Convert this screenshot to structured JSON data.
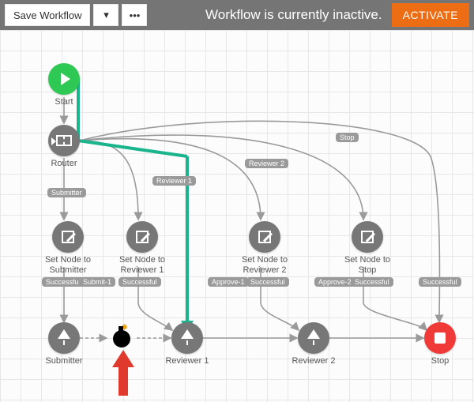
{
  "toolbar": {
    "save_label": "Save Workflow",
    "status": "Workflow is currently inactive.",
    "activate": "ACTIVATE"
  },
  "nodes": {
    "start": "Start",
    "router": "Router",
    "set_submitter": "Set Node to Submitter",
    "set_reviewer1": "Set Node to Reviewer 1",
    "set_reviewer2": "Set Node to Reviewer 2",
    "set_stop": "Set Node to Stop",
    "submitter": "Submitter",
    "reviewer1": "Reviewer 1",
    "reviewer2": "Reviewer 2",
    "stop": "Stop"
  },
  "edges": {
    "submitter": "Submitter",
    "reviewer1": "Reviewer 1",
    "reviewer2": "Reviewer 2",
    "stop": "Stop",
    "successful": "Successful",
    "submit1": "Submit-1",
    "approve1": "Approve-1",
    "approve2": "Approve-2"
  },
  "colors": {
    "accent_green": "#1ab58d",
    "activate_orange": "#ec6d14",
    "start_green": "#2dc954",
    "stop_red": "#ef3a37",
    "node_gray": "#777777",
    "annotation_red": "#e03a2f"
  },
  "chart_data": {
    "type": "diagram",
    "title": "Workflow",
    "nodes": [
      {
        "id": "start",
        "kind": "start",
        "label": "Start"
      },
      {
        "id": "router",
        "kind": "router",
        "label": "Router"
      },
      {
        "id": "sn_sub",
        "kind": "action",
        "label": "Set Node to Submitter"
      },
      {
        "id": "sn_r1",
        "kind": "action",
        "label": "Set Node to Reviewer 1"
      },
      {
        "id": "sn_r2",
        "kind": "action",
        "label": "Set Node to Reviewer 2"
      },
      {
        "id": "sn_stop",
        "kind": "action",
        "label": "Set Node to Stop"
      },
      {
        "id": "submitter",
        "kind": "merge",
        "label": "Submitter"
      },
      {
        "id": "reviewer1",
        "kind": "merge",
        "label": "Reviewer 1"
      },
      {
        "id": "reviewer2",
        "kind": "merge",
        "label": "Reviewer 2"
      },
      {
        "id": "stop",
        "kind": "stop",
        "label": "Stop"
      },
      {
        "id": "bomb",
        "kind": "error",
        "label": ""
      }
    ],
    "edges": [
      {
        "from": "start",
        "to": "router",
        "label": null
      },
      {
        "from": "router",
        "to": "sn_sub",
        "label": "Submitter"
      },
      {
        "from": "router",
        "to": "sn_r1",
        "label": "Reviewer 1"
      },
      {
        "from": "router",
        "to": "sn_r2",
        "label": "Reviewer 2"
      },
      {
        "from": "router",
        "to": "sn_stop",
        "label": "Stop"
      },
      {
        "from": "sn_sub",
        "to": "submitter",
        "label": "Successful"
      },
      {
        "from": "sn_r1",
        "to": "reviewer1",
        "label": "Successful"
      },
      {
        "from": "sn_r2",
        "to": "reviewer2",
        "label": "Successful"
      },
      {
        "from": "sn_stop",
        "to": "stop",
        "label": "Successful"
      },
      {
        "from": "submitter",
        "to": "bomb",
        "label": "Submit-1"
      },
      {
        "from": "bomb",
        "to": "reviewer1",
        "label": null
      },
      {
        "from": "reviewer1",
        "to": "reviewer2",
        "label": "Approve-1"
      },
      {
        "from": "reviewer2",
        "to": "stop",
        "label": "Approve-2"
      }
    ],
    "highlight_path": [
      "start",
      "router",
      "reviewer1"
    ],
    "annotation": {
      "type": "red-arrow",
      "points_to": "bomb"
    }
  }
}
